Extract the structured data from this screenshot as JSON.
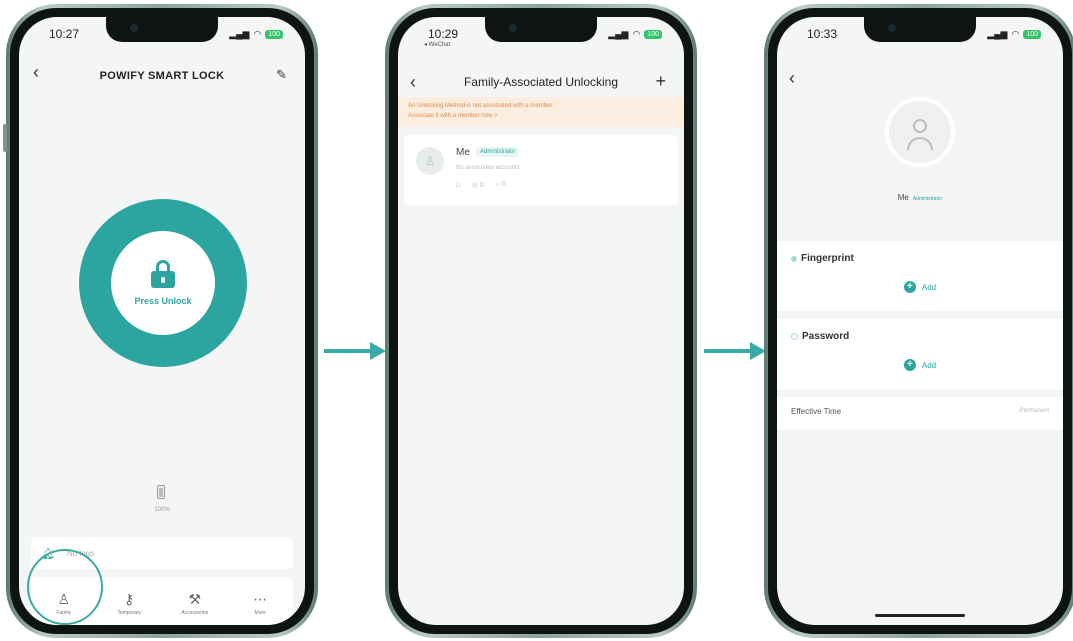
{
  "colors": {
    "accent": "#2ca5a0",
    "warning_bg": "#fbeee1",
    "warning_text": "#e38a4a",
    "battery": "#35c36a"
  },
  "phone1": {
    "status_time": "10:27",
    "battery_badge": "100",
    "header_subtitle": "",
    "title": "POWIFY SMART LOCK",
    "unlock_label": "Press Unlock",
    "battery_level": "100%",
    "logs_text": "No logs",
    "tabs": [
      {
        "icon": "family-icon",
        "label": "Family"
      },
      {
        "icon": "key-icon",
        "label": "Temporary"
      },
      {
        "icon": "tools-icon",
        "label": "Accessories"
      },
      {
        "icon": "more-icon",
        "label": "More"
      }
    ]
  },
  "phone2": {
    "status_time": "10:29",
    "back_to_app": "◂ WeChat",
    "battery_badge": "100",
    "title": "Family-Associated Unlocking",
    "warning_line1": "An Unlocking Method is not associated with a member.",
    "warning_line2": "Associate it with a member now >",
    "member": {
      "name": "Me",
      "role": "Administrator",
      "sub": "No associated accounts",
      "fingerprint_count": "0",
      "password_count": "0"
    }
  },
  "phone3": {
    "status_time": "10:33",
    "battery_badge": "100",
    "name": "Me",
    "role": "Administrator",
    "fingerprint_title": "Fingerprint",
    "password_title": "Password",
    "add_label": "Add",
    "effective_time_label": "Effective Time",
    "effective_time_value": "Permanent"
  }
}
